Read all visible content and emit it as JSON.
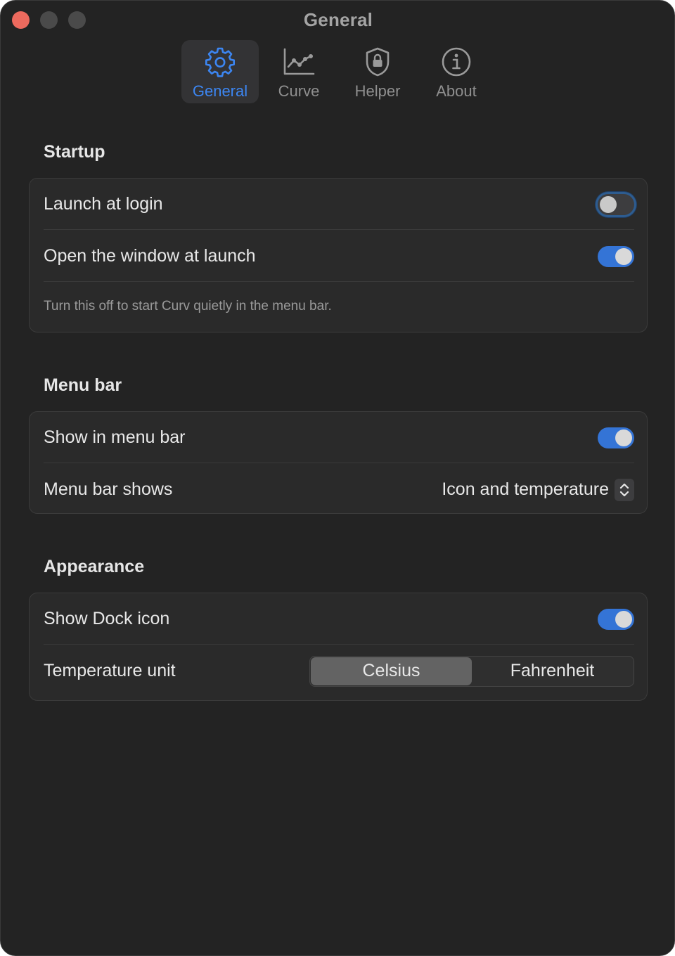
{
  "window": {
    "title": "General"
  },
  "tabs": [
    {
      "label": "General",
      "icon": "gear-icon",
      "active": true
    },
    {
      "label": "Curve",
      "icon": "chart-line-icon",
      "active": false
    },
    {
      "label": "Helper",
      "icon": "lock-shield-icon",
      "active": false
    },
    {
      "label": "About",
      "icon": "info-circle-icon",
      "active": false
    }
  ],
  "sections": {
    "startup": {
      "title": "Startup",
      "launch_at_login": {
        "label": "Launch at login",
        "on": false
      },
      "open_window_at_launch": {
        "label": "Open the window at launch",
        "on": true
      },
      "note": "Turn this off to start Curv quietly in the menu bar."
    },
    "menu_bar": {
      "title": "Menu bar",
      "show_in_menu_bar": {
        "label": "Show in menu bar",
        "on": true
      },
      "menu_bar_shows": {
        "label": "Menu bar shows",
        "value": "Icon and temperature"
      }
    },
    "appearance": {
      "title": "Appearance",
      "show_dock_icon": {
        "label": "Show Dock icon",
        "on": true
      },
      "temperature_unit": {
        "label": "Temperature unit",
        "options": [
          "Celsius",
          "Fahrenheit"
        ],
        "selected": "Celsius"
      }
    }
  },
  "colors": {
    "accent": "#3c86f2",
    "toggle_on": "#3474d6",
    "close": "#ed6a5e",
    "background": "#232323"
  }
}
